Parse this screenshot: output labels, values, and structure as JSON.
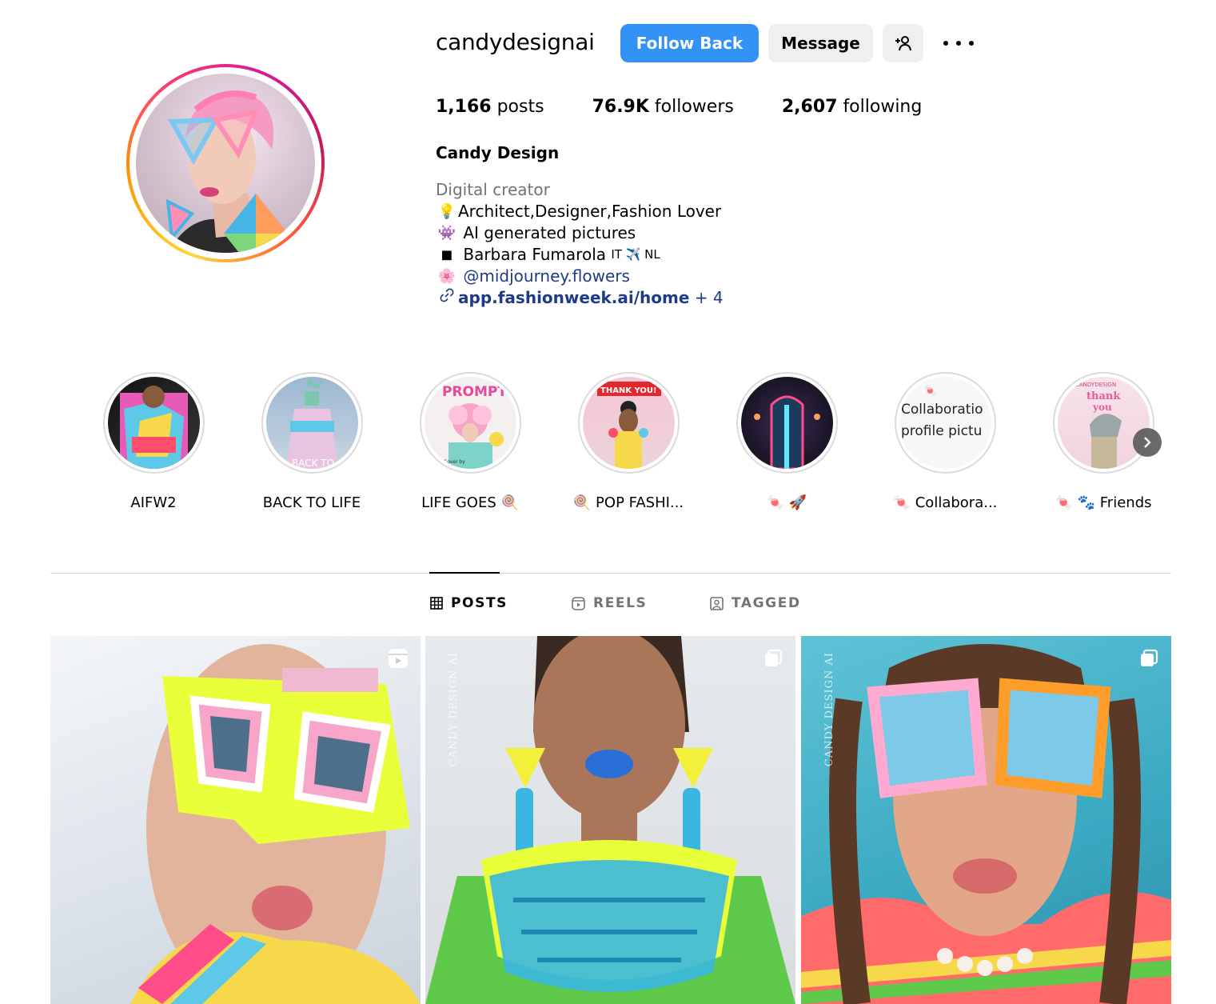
{
  "profile": {
    "username": "candydesignai",
    "follow_label": "Follow Back",
    "message_label": "Message",
    "stats": {
      "posts_value": "1,166",
      "posts_label": "posts",
      "followers_value": "76.9K",
      "followers_label": "followers",
      "following_value": "2,607",
      "following_label": "following"
    },
    "full_name": "Candy Design",
    "category": "Digital creator",
    "bio": [
      {
        "emoji": "💡",
        "text": "Architect,Designer,Fashion Lover"
      },
      {
        "emoji": "👾",
        "text": "AI generated pictures"
      },
      {
        "emoji": "◼",
        "text": "Barbara Fumarola",
        "suffix": "IT ✈️ NL"
      },
      {
        "emoji": "🌸",
        "text": "@midjourney.flowers"
      }
    ],
    "link": {
      "icon": "link-icon",
      "text": "app.fashionweek.ai/home",
      "extra": "+ 4"
    }
  },
  "highlights": [
    {
      "label": "AIFW2"
    },
    {
      "label": "BACK TO LIFE",
      "image_text": "BACK TO"
    },
    {
      "label": "LIFE GOES 🍭",
      "image_text": "PROMPT",
      "caption": "Cover by"
    },
    {
      "label": "🍭 POP FASHI...",
      "image_text": "THANK YOU!"
    },
    {
      "label": "🍬 🚀"
    },
    {
      "label": "🍬 Collabora...",
      "image_text_1": "Collaboratio",
      "image_text_2": "profile pictu"
    },
    {
      "label": "🍬 🐾 Friends",
      "image_text_1": "CANDYDESIGN",
      "image_text_2": "thank",
      "image_text_3": "you"
    }
  ],
  "tabs": [
    {
      "label": "POSTS",
      "icon": "grid-icon",
      "active": true
    },
    {
      "label": "REELS",
      "icon": "reels-icon",
      "active": false
    },
    {
      "label": "TAGGED",
      "icon": "tagged-icon",
      "active": false
    }
  ],
  "posts": [
    {
      "badge": "reel-icon"
    },
    {
      "badge": "carousel-icon",
      "watermark": "CANDY DESIGN AI"
    },
    {
      "badge": "carousel-icon",
      "watermark": "CANDY DESIGN AI"
    }
  ],
  "colors": {
    "primary_button": "#3392f5",
    "secondary_button": "#efefef",
    "link": "#1e3a8a",
    "muted_text": "#737373"
  }
}
